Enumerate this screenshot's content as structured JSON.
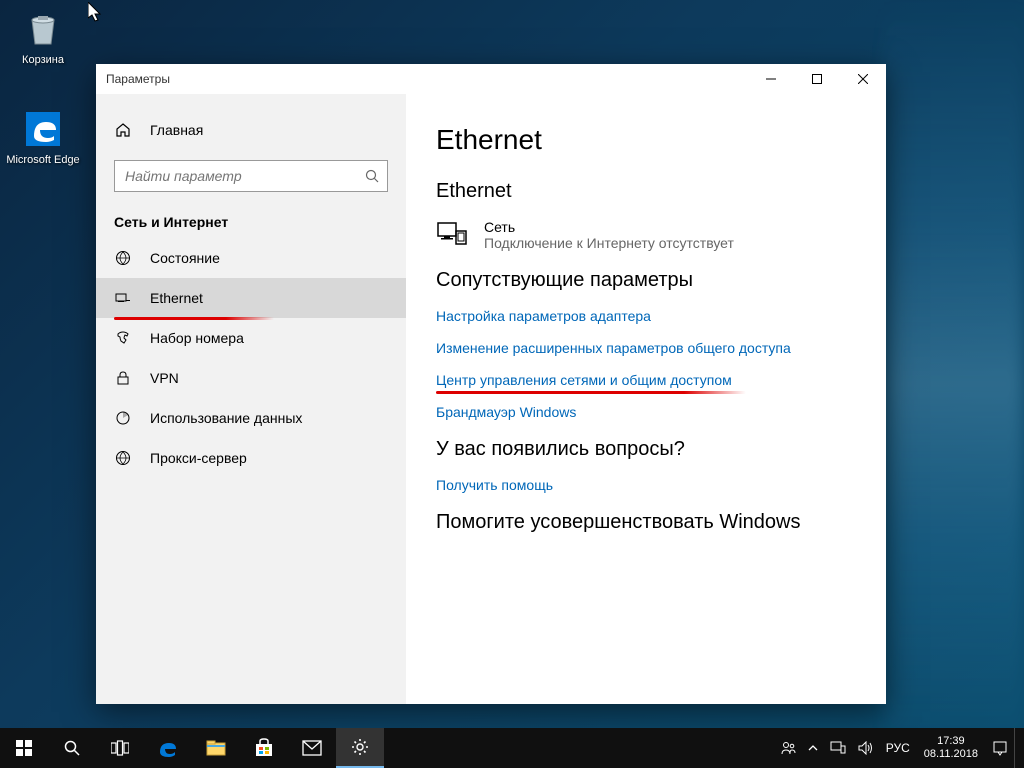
{
  "desktop": {
    "recycle_bin": "Корзина",
    "edge": "Microsoft Edge"
  },
  "window": {
    "title": "Параметры",
    "home_label": "Главная",
    "search_placeholder": "Найти параметр",
    "category": "Сеть и Интернет",
    "nav": {
      "status": "Состояние",
      "ethernet": "Ethernet",
      "dialup": "Набор номера",
      "vpn": "VPN",
      "data_usage": "Использование данных",
      "proxy": "Прокси-сервер"
    }
  },
  "content": {
    "title": "Ethernet",
    "subtitle": "Ethernet",
    "network": {
      "name": "Сеть",
      "status": "Подключение к Интернету отсутствует"
    },
    "related_heading": "Сопутствующие параметры",
    "links": {
      "adapter": "Настройка параметров адаптера",
      "sharing": "Изменение расширенных параметров общего доступа",
      "center": "Центр управления сетями и общим доступом",
      "firewall": "Брандмауэр Windows"
    },
    "help_heading": "У вас появились вопросы?",
    "help_link": "Получить помощь",
    "improve_heading": "Помогите усовершенствовать Windows"
  },
  "taskbar": {
    "lang": "РУС",
    "time": "17:39",
    "date": "08.11.2018"
  }
}
